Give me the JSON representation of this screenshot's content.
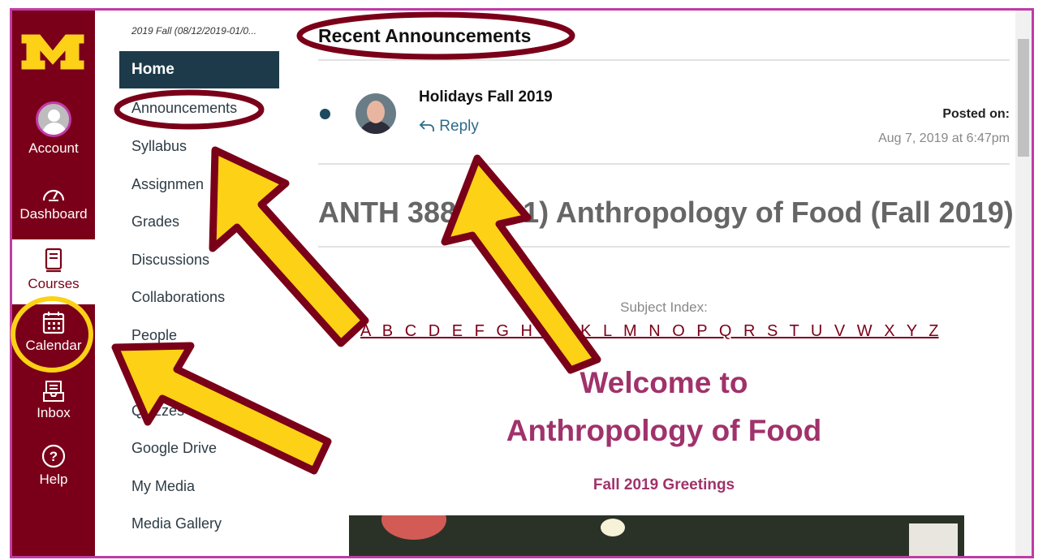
{
  "global_nav": {
    "brand_color": "#7a0019",
    "logo_icon": "university-m-logo",
    "items": [
      {
        "label": "Account",
        "icon": "account-avatar-icon"
      },
      {
        "label": "Dashboard",
        "icon": "dashboard-gauge-icon"
      },
      {
        "label": "Courses",
        "icon": "courses-book-icon"
      },
      {
        "label": "Calendar",
        "icon": "calendar-icon"
      },
      {
        "label": "Inbox",
        "icon": "inbox-icon"
      },
      {
        "label": "Help",
        "icon": "help-question-icon"
      }
    ]
  },
  "course_nav": {
    "term": "2019 Fall (08/12/2019-01/0...",
    "items": [
      "Home",
      "Announcements",
      "Syllabus",
      "Assignmen",
      "Grades",
      "Discussions",
      "Collaborations",
      "People",
      "Quizzes",
      "Google Drive",
      "My Media",
      "Media Gallery"
    ]
  },
  "main": {
    "recent_announcements_title": "Recent Announcements",
    "announcement": {
      "title": "Holidays Fall 2019",
      "reply_label": "Reply",
      "posted_label": "Posted on:",
      "posted_date": "Aug 7, 2019 at 6:47pm"
    },
    "course_title": "ANTH 3888 (001) Anthropology of Food (Fall 2019)",
    "subject_index_label": "Subject Index:",
    "subject_letters": "A B C D E F G H I J K L M N O P Q R S T U V W X Y Z",
    "welcome_line1": "Welcome to",
    "welcome_line2": "Anthropology of Food",
    "greeting": "Fall 2019 Greetings"
  },
  "annotation_colors": {
    "arrow_fill": "#fcd116",
    "arrow_stroke": "#7a0019",
    "circle": "#fcd116"
  }
}
